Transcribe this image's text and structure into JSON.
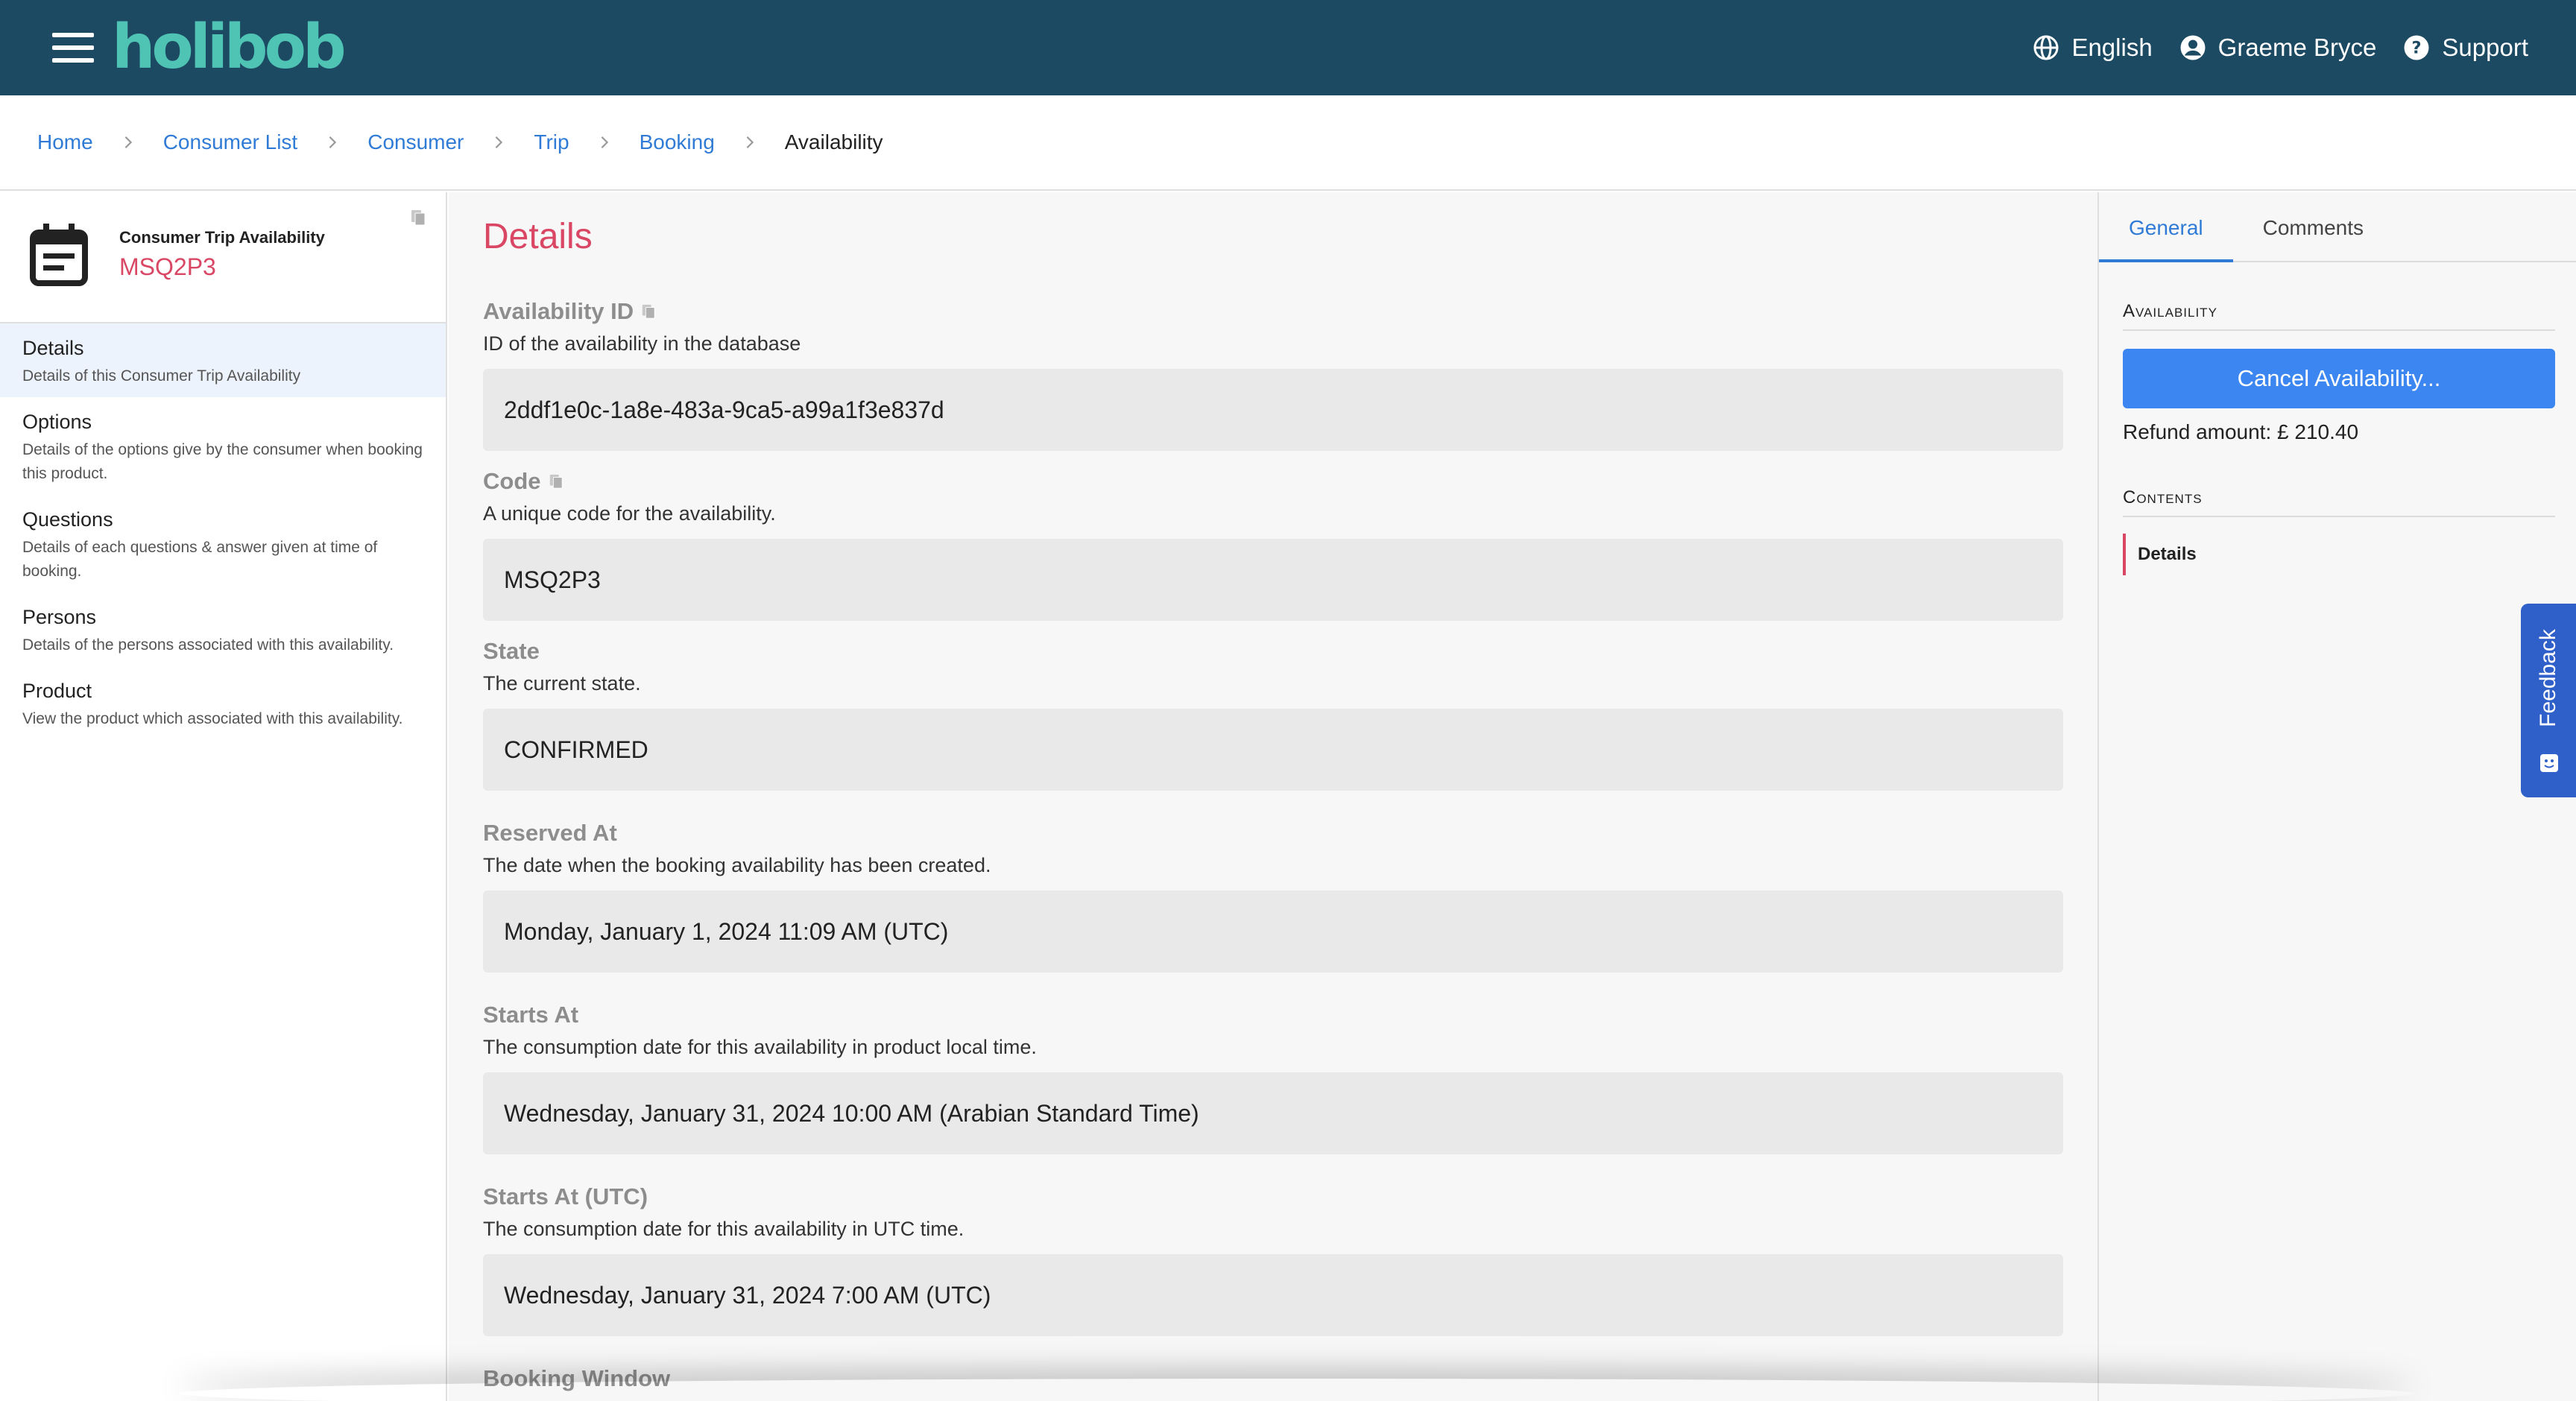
{
  "app": {
    "logo": "holibob"
  },
  "topnav": {
    "language": "English",
    "user": "Graeme Bryce",
    "support": "Support"
  },
  "breadcrumb": [
    {
      "label": "Home"
    },
    {
      "label": "Consumer List"
    },
    {
      "label": "Consumer"
    },
    {
      "label": "Trip"
    },
    {
      "label": "Booking"
    },
    {
      "label": "Availability"
    }
  ],
  "entity": {
    "type": "Consumer Trip Availability",
    "code": "MSQ2P3"
  },
  "sidebar": {
    "items": [
      {
        "title": "Details",
        "desc": "Details of this Consumer Trip Availability"
      },
      {
        "title": "Options",
        "desc": "Details of the options give by the consumer when booking this product."
      },
      {
        "title": "Questions",
        "desc": "Details of each questions & answer given at time of booking."
      },
      {
        "title": "Persons",
        "desc": "Details of the persons associated with this availability."
      },
      {
        "title": "Product",
        "desc": "View the product which associated with this availability."
      }
    ]
  },
  "main": {
    "title": "Details",
    "fields": [
      {
        "label": "Availability ID",
        "desc": "ID of the availability in the database",
        "value": "2ddf1e0c-1a8e-483a-9ca5-a99a1f3e837d"
      },
      {
        "label": "Code",
        "desc": "A unique code for the availability.",
        "value": "MSQ2P3"
      },
      {
        "label": "State",
        "desc": "The current state.",
        "value": "CONFIRMED"
      },
      {
        "label": "Reserved At",
        "desc": "The date when the booking availability has been created.",
        "value": "Monday, January 1, 2024 11:09 AM (UTC)"
      },
      {
        "label": "Starts At",
        "desc": "The consumption date for this availability in product local time.",
        "value": "Wednesday, January 31, 2024 10:00 AM (Arabian Standard Time)"
      },
      {
        "label": "Starts At (UTC)",
        "desc": "The consumption date for this availability in UTC time.",
        "value": "Wednesday, January 31, 2024 7:00 AM (UTC)"
      },
      {
        "label": "Booking Window"
      }
    ]
  },
  "rightpanel": {
    "tabs": [
      "General",
      "Comments"
    ],
    "availability_head": "Availability",
    "cancel_label": "Cancel Availability...",
    "refund": "Refund amount: £ 210.40",
    "contents_head": "Contents",
    "contents_item": "Details"
  },
  "feedback": {
    "label": "Feedback"
  },
  "colors": {
    "topbar": "#1c4a62",
    "logo": "#4fc3b4",
    "accent_pink": "#d94764",
    "link_blue": "#2f7bd6",
    "button_blue": "#3b86f0",
    "feedback_blue": "#2f5fc9"
  }
}
